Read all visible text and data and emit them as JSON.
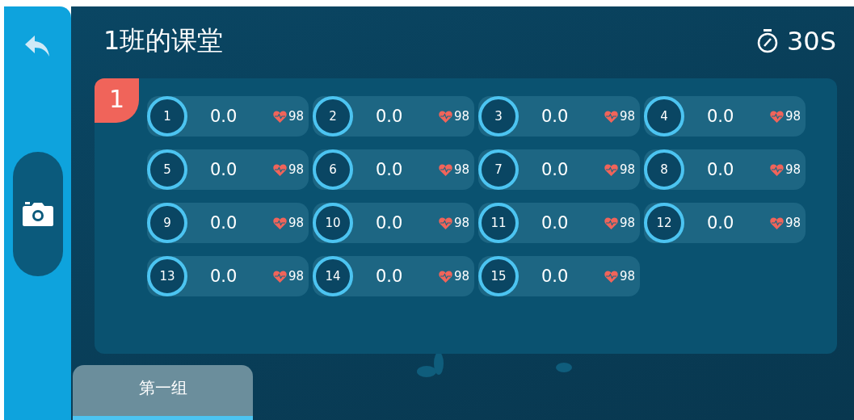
{
  "title": "1班的课堂",
  "timer": "30S",
  "group_badge": "1",
  "students": [
    {
      "number": "1",
      "score": "0.0",
      "heart_rate": "98"
    },
    {
      "number": "2",
      "score": "0.0",
      "heart_rate": "98"
    },
    {
      "number": "3",
      "score": "0.0",
      "heart_rate": "98"
    },
    {
      "number": "4",
      "score": "0.0",
      "heart_rate": "98"
    },
    {
      "number": "5",
      "score": "0.0",
      "heart_rate": "98"
    },
    {
      "number": "6",
      "score": "0.0",
      "heart_rate": "98"
    },
    {
      "number": "7",
      "score": "0.0",
      "heart_rate": "98"
    },
    {
      "number": "8",
      "score": "0.0",
      "heart_rate": "98"
    },
    {
      "number": "9",
      "score": "0.0",
      "heart_rate": "98"
    },
    {
      "number": "10",
      "score": "0.0",
      "heart_rate": "98"
    },
    {
      "number": "11",
      "score": "0.0",
      "heart_rate": "98"
    },
    {
      "number": "12",
      "score": "0.0",
      "heart_rate": "98"
    },
    {
      "number": "13",
      "score": "0.0",
      "heart_rate": "98"
    },
    {
      "number": "14",
      "score": "0.0",
      "heart_rate": "98"
    },
    {
      "number": "15",
      "score": "0.0",
      "heart_rate": "98"
    }
  ],
  "tabs": [
    {
      "label": "第一组",
      "selected": true
    }
  ]
}
